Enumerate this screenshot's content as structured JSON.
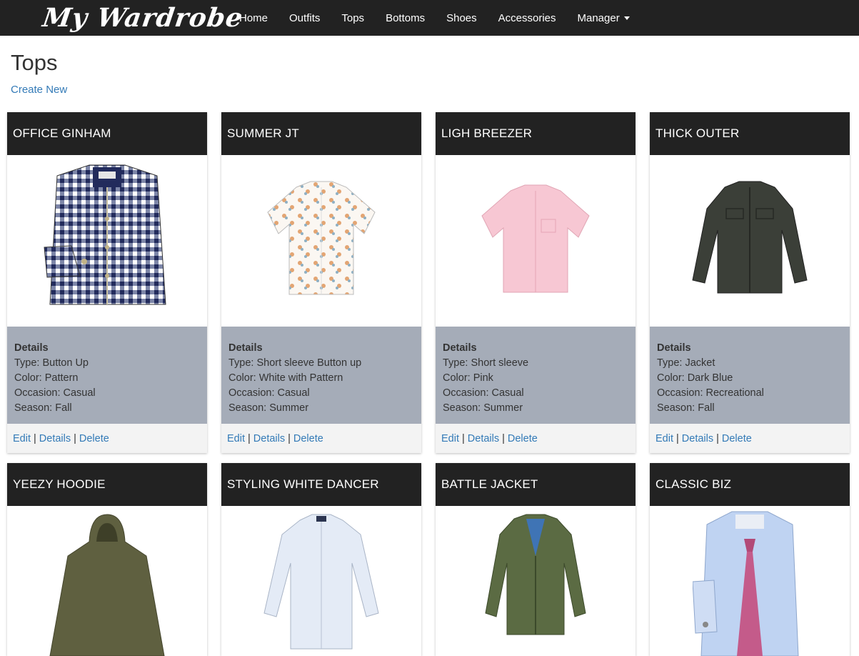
{
  "brand": "My Wardrobe",
  "nav": {
    "home": "Home",
    "outfits": "Outfits",
    "tops": "Tops",
    "bottoms": "Bottoms",
    "shoes": "Shoes",
    "accessories": "Accessories",
    "manager": "Manager"
  },
  "page": {
    "title": "Tops",
    "create_new": "Create New"
  },
  "cards": [
    {
      "title": "OFFICE GINHAM",
      "details_header": "Details",
      "type": "Type: Button Up",
      "color": "Color: Pattern",
      "occasion": "Occasion: Casual",
      "season": "Season: Fall",
      "edit": "Edit",
      "details": "Details",
      "delete": "Delete"
    },
    {
      "title": "SUMMER JT",
      "details_header": "Details",
      "type": "Type: Short sleeve Button up",
      "color": "Color: White with Pattern",
      "occasion": "Occasion: Casual",
      "season": "Season: Summer",
      "edit": "Edit",
      "details": "Details",
      "delete": "Delete"
    },
    {
      "title": "LIGH BREEZER",
      "details_header": "Details",
      "type": "Type: Short sleeve",
      "color": "Color: Pink",
      "occasion": "Occasion: Casual",
      "season": "Season: Summer",
      "edit": "Edit",
      "details": "Details",
      "delete": "Delete"
    },
    {
      "title": "THICK OUTER",
      "details_header": "Details",
      "type": "Type: Jacket",
      "color": "Color: Dark Blue",
      "occasion": "Occasion: Recreational",
      "season": "Season: Fall",
      "edit": "Edit",
      "details": "Details",
      "delete": "Delete"
    },
    {
      "title": "YEEZY HOODIE"
    },
    {
      "title": "STYLING WHITE DANCER"
    },
    {
      "title": "BATTLE JACKET"
    },
    {
      "title": "CLASSIC BIZ"
    }
  ],
  "colors": {
    "navbar": "#222222",
    "link": "#337ab7",
    "details_bg": "#a5acb8",
    "actions_bg": "#f3f3f3"
  }
}
